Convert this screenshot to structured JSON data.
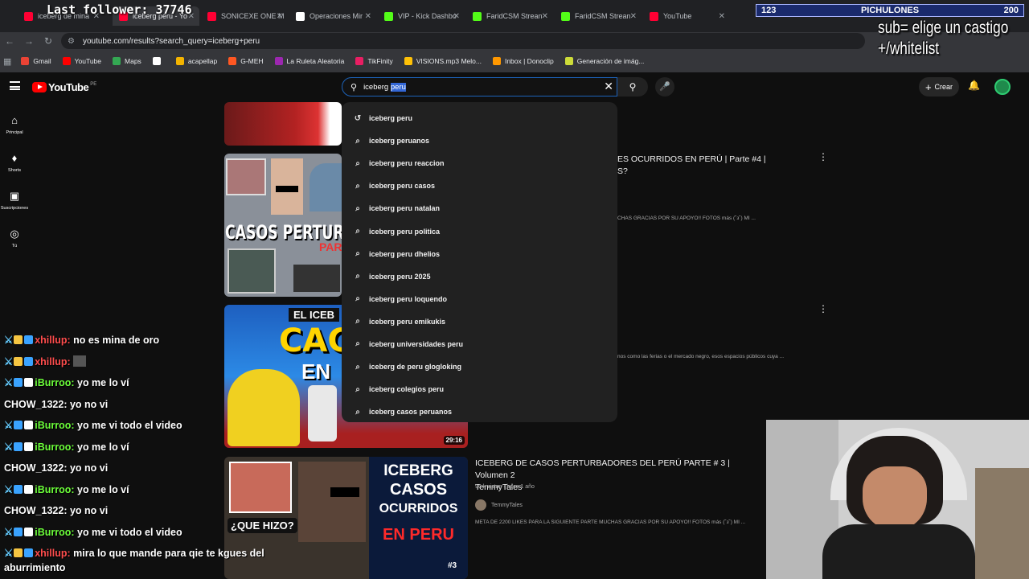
{
  "browser": {
    "tabs": [
      {
        "title": "iceberg de mina",
        "color": "#ff0033"
      },
      {
        "title": "iceberg peru - Yo",
        "color": "#ff0033"
      },
      {
        "title": "SONICEXE ONE M",
        "color": "#ff0033"
      },
      {
        "title": "Operaciones Mir",
        "color": "#ffffff"
      },
      {
        "title": "VIP - Kick Dashbo",
        "color": "#53fc18"
      },
      {
        "title": "FaridCSM Strean",
        "color": "#53fc18"
      },
      {
        "title": "FaridCSM Strean",
        "color": "#53fc18"
      },
      {
        "title": "YouTube",
        "color": "#ff0033"
      }
    ],
    "url": "youtube.com/results?search_query=iceberg+peru",
    "bookmarks": [
      {
        "label": "Gmail",
        "color": "#ea4335"
      },
      {
        "label": "YouTube",
        "color": "#ff0000"
      },
      {
        "label": "Maps",
        "color": "#34a853"
      },
      {
        "label": "",
        "color": "#ffffff"
      },
      {
        "label": "acapellap",
        "color": "#f4b400"
      },
      {
        "label": "G-MEH",
        "color": "#ff5722"
      },
      {
        "label": "La Ruleta Aleatoria",
        "color": "#9c27b0"
      },
      {
        "label": "TikFinity",
        "color": "#e91e63"
      },
      {
        "label": "VISIONS.mp3 Melo...",
        "color": "#ffc107"
      },
      {
        "label": "Inbox | Donoclip",
        "color": "#ff9800"
      },
      {
        "label": "Generación de imág...",
        "color": "#cddc39"
      }
    ]
  },
  "youtube": {
    "logo": "YouTube",
    "region": "PE",
    "search": {
      "query_prefix": "iceberg ",
      "query_selected": "peru"
    },
    "create_label": "Crear",
    "sidenav": [
      {
        "label": "Principal",
        "icon": "home-icon"
      },
      {
        "label": "Shorts",
        "icon": "shorts-icon"
      },
      {
        "label": "Suscripciones",
        "icon": "subscriptions-icon"
      },
      {
        "label": "Tú",
        "icon": "you-icon"
      }
    ],
    "suggestions": [
      {
        "text": "iceberg peru",
        "icon": "history-icon"
      },
      {
        "text": "iceberg peruanos",
        "icon": "search-icon"
      },
      {
        "text": "iceberg peru reaccion",
        "icon": "search-icon"
      },
      {
        "text": "iceberg peru casos",
        "icon": "search-icon"
      },
      {
        "text": "iceberg peru natalan",
        "icon": "search-icon"
      },
      {
        "text": "iceberg peru politica",
        "icon": "search-icon"
      },
      {
        "text": "iceberg peru dhelios",
        "icon": "search-icon"
      },
      {
        "text": "iceberg peru 2025",
        "icon": "search-icon"
      },
      {
        "text": "iceberg peru loquendo",
        "icon": "search-icon"
      },
      {
        "text": "iceberg peru emikukis",
        "icon": "search-icon"
      },
      {
        "text": "iceberg universidades peru",
        "icon": "search-icon"
      },
      {
        "text": "iceberg de peru glogloking",
        "icon": "search-icon"
      },
      {
        "text": "iceberg colegios peru",
        "icon": "search-icon"
      },
      {
        "text": "iceberg casos peruanos",
        "icon": "search-icon"
      }
    ],
    "results": [
      {
        "title_line1": "ES OCURRIDOS EN PERÚ | Parte #4 |",
        "title_line2": "S?",
        "thumb_text": "CASOS PERTUR",
        "thumb_text2": "PAR",
        "desc": "CHAS GRACIAS POR SU APOYO!! FOTOS más (˘з˘) MI ..."
      },
      {
        "thumb_text": "CACH",
        "thumb_text2": "EN",
        "thumb_badge": "EL ICEB",
        "duration": "29:16",
        "desc": "nos como las ferias o el mercado negro, esos espacios públicos cuya ..."
      },
      {
        "title_line1": "ICEBERG DE CASOS PERTURBADORES DEL PERÚ PARTE # 3 | Volumen 2",
        "title_line2": "TemmyTales",
        "meta": "96 k vistas · hace 1 año",
        "channel": "TemmyTales",
        "desc": "META DE 2200 LIKES PARA LA SIGUIENTE PARTE MUCHAS GRACIAS POR SU APOYO!! FOTOS más (˘з˘) MI ...",
        "thumb_text": "ICEBERG",
        "thumb_text2": "CASOS",
        "thumb_text3": "OCURRIDOS",
        "thumb_text4": "EN PERU",
        "thumb_caption": "¿QUE HIZO?",
        "thumb_num": "#3"
      }
    ]
  },
  "overlay": {
    "last_follower": "Last follower: 37746",
    "goal_left": "123",
    "goal_name": "PICHULONES",
    "goal_right": "200",
    "sub_line1": "sub= elige un castigo",
    "sub_line2": "+/whitelist"
  },
  "chat": [
    {
      "user": "xhillup",
      "text": "no es mina de oro",
      "color": "#ff4d4d",
      "badges": [
        "#f5c542",
        "#3aa3ff"
      ]
    },
    {
      "user": "xhillup",
      "text": "",
      "color": "#ff4d4d",
      "badges": [
        "#f5c542",
        "#3aa3ff"
      ]
    },
    {
      "user": "iBurroo",
      "text": "yo me lo ví",
      "color": "#6cff3a",
      "badges": [
        "#3aa3ff",
        "#ffffff"
      ]
    },
    {
      "user": "CHOW_1322",
      "text": "yo no vi",
      "color": "#ffffff",
      "badges": []
    },
    {
      "user": "iBurroo",
      "text": "yo me vi todo el video",
      "color": "#6cff3a",
      "badges": [
        "#3aa3ff",
        "#ffffff"
      ]
    },
    {
      "user": "iBurroo",
      "text": "yo me lo ví",
      "color": "#6cff3a",
      "badges": [
        "#3aa3ff",
        "#ffffff"
      ]
    },
    {
      "user": "CHOW_1322",
      "text": "yo no vi",
      "color": "#ffffff",
      "badges": []
    },
    {
      "user": "iBurroo",
      "text": "yo me lo ví",
      "color": "#6cff3a",
      "badges": [
        "#3aa3ff",
        "#ffffff"
      ]
    },
    {
      "user": "CHOW_1322",
      "text": "yo no vi",
      "color": "#ffffff",
      "badges": []
    },
    {
      "user": "iBurroo",
      "text": "yo me vi todo el video",
      "color": "#6cff3a",
      "badges": [
        "#3aa3ff",
        "#ffffff"
      ]
    },
    {
      "user": "xhillup",
      "text": "mira lo que mande para qie te kgues del aburrimiento",
      "color": "#ff4d4d",
      "badges": [
        "#f5c542",
        "#3aa3ff"
      ]
    }
  ]
}
